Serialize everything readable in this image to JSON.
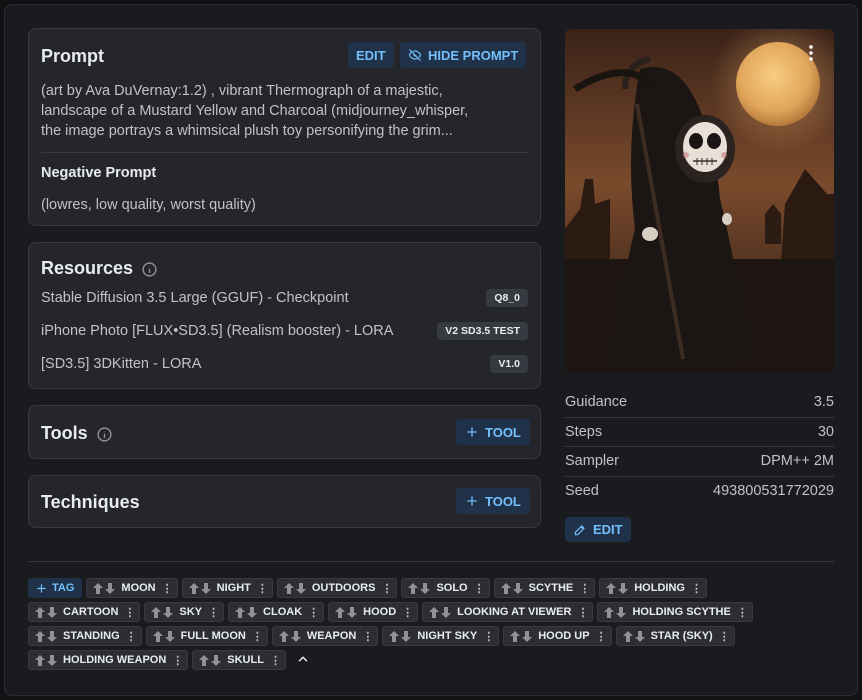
{
  "prompt": {
    "title": "Prompt",
    "edit_label": "EDIT",
    "hide_label": "HIDE PROMPT",
    "line1": "(art by Ava DuVernay:1.2) , vibrant Thermograph of a majestic,",
    "line2": "landscape of a Mustard Yellow and Charcoal (midjourney_whisper,",
    "line3": "the image portrays a whimsical plush toy personifying the grim...",
    "negative_title": "Negative Prompt",
    "negative_text": "(lowres, low quality, worst quality)"
  },
  "resources": {
    "title": "Resources",
    "items": [
      {
        "name": "Stable Diffusion 3.5 Large (GGUF) - Checkpoint",
        "badge": "Q8_0"
      },
      {
        "name": "iPhone Photo [FLUX•SD3.5] (Realism booster) - LORA",
        "badge": "V2 SD3.5 TEST"
      },
      {
        "name": "[SD3.5] 3DKitten - LORA",
        "badge": "V1.0"
      }
    ]
  },
  "tools": {
    "title": "Tools",
    "button": "TOOL"
  },
  "techniques": {
    "title": "Techniques",
    "button": "TOOL"
  },
  "params": [
    {
      "label": "Guidance",
      "value": "3.5"
    },
    {
      "label": "Steps",
      "value": "30"
    },
    {
      "label": "Sampler",
      "value": "DPM++ 2M"
    },
    {
      "label": "Seed",
      "value": "493800531772029"
    }
  ],
  "params_edit": "EDIT",
  "tag_add": "TAG",
  "tag_rows": [
    [
      "MOON",
      "NIGHT",
      "OUTDOORS",
      "SOLO",
      "SCYTHE",
      "HOLDING"
    ],
    [
      "CARTOON",
      "SKY",
      "CLOAK",
      "HOOD",
      "LOOKING AT VIEWER",
      "HOLDING SCYTHE"
    ],
    [
      "STANDING",
      "FULL MOON",
      "WEAPON",
      "NIGHT SKY",
      "HOOD UP",
      "STAR (SKY)"
    ],
    [
      "HOLDING WEAPON",
      "SKULL"
    ]
  ],
  "colors": {
    "accent": "#74c0fc",
    "accent_bg": "#1f3249",
    "card": "#25262b",
    "border": "#373a40"
  }
}
